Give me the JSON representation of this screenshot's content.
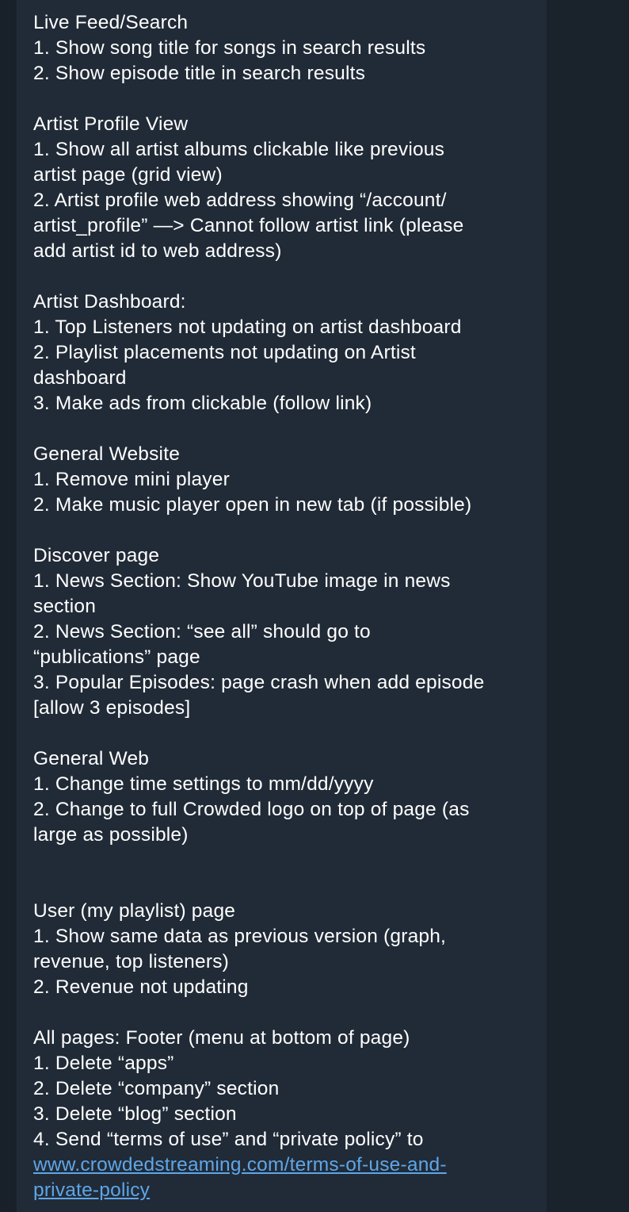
{
  "message": {
    "lines": [
      "Live Feed/Search",
      "1. Show song title for songs in search results",
      "2. Show episode title in search results",
      "",
      "Artist Profile View",
      "1. Show all artist albums clickable like previous",
      "artist page (grid view)",
      "2. Artist profile web address showing “/account/",
      "artist_profile” —> Cannot follow artist link (please",
      "add artist id to web address)",
      "",
      "Artist Dashboard:",
      "1. Top Listeners not updating on artist dashboard",
      "2. Playlist placements not updating on Artist",
      "dashboard",
      "3. Make ads from clickable (follow link)",
      "",
      "General Website",
      "1. Remove mini player",
      "2. Make music player open in new tab (if possible)",
      "",
      "Discover page",
      "1. News Section: Show YouTube image in news",
      "section",
      "2. News Section: “see all” should go to",
      "“publications” page",
      "3. Popular Episodes: page crash when add episode",
      "[allow 3 episodes]",
      "",
      "General Web",
      "1. Change time settings to mm/dd/yyyy",
      "2. Change to full Crowded logo on top of page (as",
      "large as possible)",
      "",
      "",
      "User (my playlist) page",
      "1. Show same data as previous version (graph,",
      "revenue, top listeners)",
      "2. Revenue not updating",
      "",
      "All pages: Footer (menu at bottom of page)",
      "1. Delete “apps”",
      "2. Delete “company” section",
      "3. Delete “blog” section",
      "4. Send “terms of use” and “private policy” to"
    ],
    "link_lines": [
      "www.crowdedstreaming.com/terms-of-use-and-",
      "private-policy"
    ]
  },
  "colors": {
    "text": "#ffffff",
    "link": "#5ea6e8",
    "bubble": "#212b37",
    "background": "#1a222c"
  }
}
